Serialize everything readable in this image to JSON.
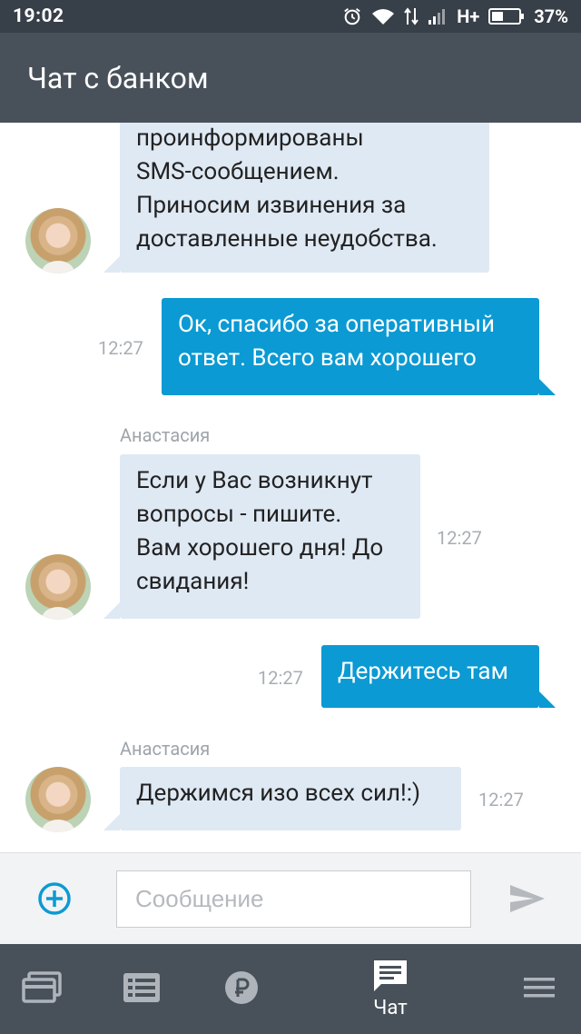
{
  "status_bar": {
    "time": "19:02",
    "network": "H+",
    "battery": "37%"
  },
  "app_bar": {
    "title": "Чат с банком"
  },
  "messages": [
    {
      "direction": "in",
      "lines": [
        "проинформированы",
        "SMS-сообщением.",
        "Приносим извинения за",
        "доставленные неудобства."
      ]
    },
    {
      "direction": "out",
      "time": "12:27",
      "lines": [
        "Ок, спасибо за оперативный",
        "ответ. Всего вам хорошего"
      ]
    },
    {
      "direction": "in",
      "sender": "Анастасия",
      "time": "12:27",
      "lines": [
        "Если у Вас возникнут",
        "вопросы - пишите.",
        "Вам хорошего дня! До",
        "свидания!"
      ]
    },
    {
      "direction": "out",
      "time": "12:27",
      "lines": [
        "Держитесь там"
      ]
    },
    {
      "direction": "in",
      "sender": "Анастасия",
      "time": "12:27",
      "lines": [
        "Держимся изо всех сил!:)"
      ]
    }
  ],
  "input_bar": {
    "placeholder": "Сообщение",
    "value": ""
  },
  "bottom_nav": {
    "items": [
      {
        "icon": "cards-icon",
        "label": ""
      },
      {
        "icon": "list-icon",
        "label": ""
      },
      {
        "icon": "ruble-icon",
        "label": ""
      },
      {
        "icon": "chat-icon",
        "label": "Чат",
        "active": true
      },
      {
        "icon": "menu-icon",
        "label": ""
      }
    ]
  },
  "colors": {
    "status_bar": "#373f48",
    "app_bar": "#48515a",
    "incoming_bubble": "#dfe9f4",
    "outgoing_bubble": "#0b9ad3",
    "accent": "#0b9ad3"
  }
}
